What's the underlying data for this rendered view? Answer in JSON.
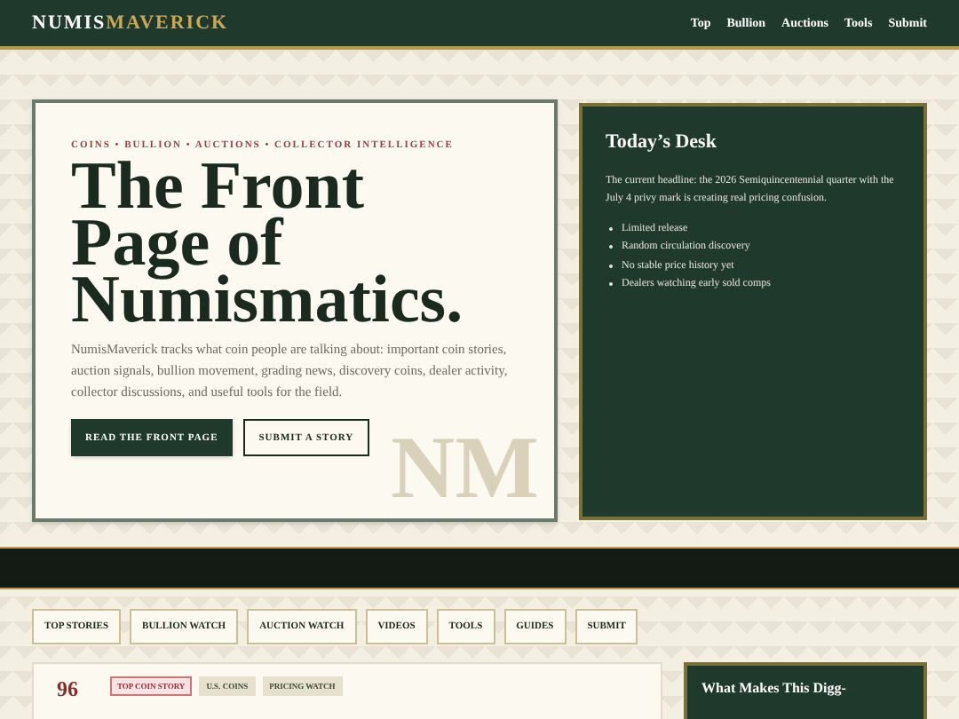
{
  "header": {
    "logo_left": "NUMIS",
    "logo_right": "MAVERICK",
    "nav": [
      "Top",
      "Bullion",
      "Auctions",
      "Tools",
      "Submit"
    ]
  },
  "hero": {
    "eyebrow": "COINS • BULLION • AUCTIONS • COLLECTOR INTELLIGENCE",
    "title_lines": [
      "The Front",
      "Page of",
      "Numismatics."
    ],
    "body": "NumisMaverick tracks what coin people are talking about: important coin stories, auction signals, bullion movement, grading news, discovery coins, dealer activity, collector discussions, and useful tools for the field.",
    "watermark": "NM",
    "buttons": [
      {
        "label": "READ THE FRONT PAGE",
        "kind": "primary"
      },
      {
        "label": "SUBMIT A STORY",
        "kind": "outline"
      }
    ]
  },
  "desk": {
    "title": "Today’s Desk",
    "body": "The current headline: the 2026 Semiquincentennial quarter with the July 4 privy mark is creating real pricing confusion.",
    "bullets": [
      "Limited release",
      "Random circulation discovery",
      "No stable price history yet",
      "Dealers watching early sold comps"
    ]
  },
  "tabs": [
    {
      "label": "TOP STORIES"
    },
    {
      "label": "BULLION WATCH"
    },
    {
      "label": "AUCTION WATCH"
    },
    {
      "label": "VIDEOS"
    },
    {
      "label": "TOOLS"
    },
    {
      "label": "GUIDES"
    },
    {
      "label": "SUBMIT"
    }
  ],
  "story": {
    "rank": "96",
    "tags": [
      {
        "label": "TOP COIN STORY",
        "kind": "highlight"
      },
      {
        "label": "U.S. COINS",
        "kind": "plain"
      },
      {
        "label": "PRICING WATCH",
        "kind": "plain"
      }
    ]
  },
  "aside": {
    "title": "What Makes This Digg-"
  }
}
